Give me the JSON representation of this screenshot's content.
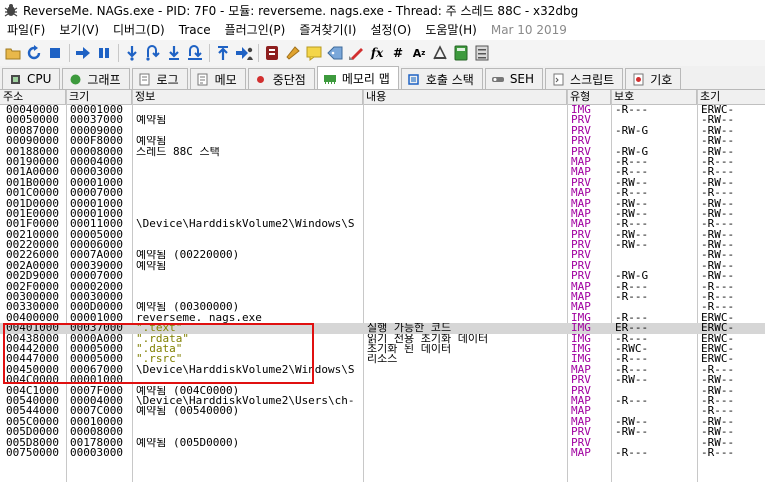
{
  "window": {
    "title": "ReverseMe. NAGs.exe - PID: 7F0 - 모듈: reverseme. nags.exe - Thread: 주 스레드 88C - x32dbg"
  },
  "menu": [
    "파일(F)",
    "보기(V)",
    "디버그(D)",
    "Trace",
    "플러그인(P)",
    "즐겨찾기(I)",
    "설정(O)",
    "도움말(H)"
  ],
  "menu_date": "Mar 10 2019",
  "toolbar": {
    "icons": [
      "open-icon",
      "restart-icon",
      "stop-icon",
      "run-icon",
      "pause-icon",
      "step-into-icon",
      "step-over-icon",
      "trace-into-icon",
      "trace-over-icon",
      "execute-till-return-icon",
      "run-to-user-code-icon",
      "script-icon",
      "patch-icon",
      "comment-icon",
      "label-icon",
      "bookmark-icon",
      "function-icon",
      "hash-icon",
      "font-icon",
      "strings-icon",
      "calculator-icon",
      "settings-icon"
    ],
    "colors": {
      "blue": "#1f62c4",
      "red": "#d22f2f",
      "orange": "#e0a32f",
      "green": "#3d9a3d"
    }
  },
  "tabs": [
    {
      "label": "CPU",
      "icon": "cpu-icon"
    },
    {
      "label": "그래프",
      "icon": "graph-icon"
    },
    {
      "label": "로그",
      "icon": "log-icon"
    },
    {
      "label": "메모",
      "icon": "notes-icon"
    },
    {
      "label": "중단점",
      "icon": "breakpoint-icon"
    },
    {
      "label": "메모리 맵",
      "icon": "memory-map-icon"
    },
    {
      "label": "호출 스택",
      "icon": "call-stack-icon"
    },
    {
      "label": "SEH",
      "icon": "seh-icon"
    },
    {
      "label": "스크립트",
      "icon": "script-tab-icon"
    },
    {
      "label": "기호",
      "icon": "symbols-icon"
    }
  ],
  "active_tab": 5,
  "columns": [
    "주소",
    "크기",
    "정보",
    "내용",
    "유형",
    "보호",
    "초기"
  ],
  "rows": [
    {
      "addr": "00040000",
      "size": "00001000",
      "info": "",
      "content": "",
      "type": "IMG",
      "prot": "-R---",
      "init": "ERWC-"
    },
    {
      "addr": "00050000",
      "size": "00037000",
      "info": "예약됨",
      "content": "",
      "type": "PRV",
      "prot": "",
      "init": "-RW--"
    },
    {
      "addr": "00087000",
      "size": "00009000",
      "info": "",
      "content": "",
      "type": "PRV",
      "prot": "-RW-G",
      "init": "-RW--"
    },
    {
      "addr": "00090000",
      "size": "000F8000",
      "info": "예약됨",
      "content": "",
      "type": "PRV",
      "prot": "",
      "init": "-RW--"
    },
    {
      "addr": "00188000",
      "size": "00008000",
      "info": "스레드 88C 스택",
      "content": "",
      "type": "PRV",
      "prot": "-RW-G",
      "init": "-RW--"
    },
    {
      "addr": "00190000",
      "size": "00004000",
      "info": "",
      "content": "",
      "type": "MAP",
      "prot": "-R---",
      "init": "-R---"
    },
    {
      "addr": "001A0000",
      "size": "00003000",
      "info": "",
      "content": "",
      "type": "MAP",
      "prot": "-R---",
      "init": "-R---"
    },
    {
      "addr": "001B0000",
      "size": "00001000",
      "info": "",
      "content": "",
      "type": "PRV",
      "prot": "-RW--",
      "init": "-RW--"
    },
    {
      "addr": "001C0000",
      "size": "00007000",
      "info": "",
      "content": "",
      "type": "MAP",
      "prot": "-R---",
      "init": "-R---"
    },
    {
      "addr": "001D0000",
      "size": "00001000",
      "info": "",
      "content": "",
      "type": "MAP",
      "prot": "-RW--",
      "init": "-RW--"
    },
    {
      "addr": "001E0000",
      "size": "00001000",
      "info": "",
      "content": "",
      "type": "MAP",
      "prot": "-RW--",
      "init": "-RW--"
    },
    {
      "addr": "001F0000",
      "size": "00011000",
      "info": "\\Device\\HarddiskVolume2\\Windows\\S",
      "content": "",
      "type": "MAP",
      "prot": "-R---",
      "init": "-R---"
    },
    {
      "addr": "00210000",
      "size": "00005000",
      "info": "",
      "content": "",
      "type": "PRV",
      "prot": "-RW--",
      "init": "-RW--"
    },
    {
      "addr": "00220000",
      "size": "00006000",
      "info": "",
      "content": "",
      "type": "PRV",
      "prot": "-RW--",
      "init": "-RW--"
    },
    {
      "addr": "00226000",
      "size": "0007A000",
      "info": "예약됨 (00220000)",
      "content": "",
      "type": "PRV",
      "prot": "",
      "init": "-RW--"
    },
    {
      "addr": "002A0000",
      "size": "00039000",
      "info": "예약됨",
      "content": "",
      "type": "PRV",
      "prot": "",
      "init": "-RW--"
    },
    {
      "addr": "002D9000",
      "size": "00007000",
      "info": "",
      "content": "",
      "type": "PRV",
      "prot": "-RW-G",
      "init": "-RW--"
    },
    {
      "addr": "002F0000",
      "size": "00002000",
      "info": "",
      "content": "",
      "type": "MAP",
      "prot": "-R---",
      "init": "-R---"
    },
    {
      "addr": "00300000",
      "size": "00030000",
      "info": "",
      "content": "",
      "type": "MAP",
      "prot": "-R---",
      "init": "-R---"
    },
    {
      "addr": "00330000",
      "size": "000D0000",
      "info": "예약됨 (00300000)",
      "content": "",
      "type": "MAP",
      "prot": "",
      "init": "-R---"
    },
    {
      "addr": "00400000",
      "size": "00001000",
      "info": "reverseme. nags.exe",
      "content": "",
      "type": "IMG",
      "prot": "-R---",
      "init": "ERWC-"
    },
    {
      "addr": "00401000",
      "size": "00037000",
      "info": " \".text\"",
      "content": "실행 가능한 코드",
      "type": "IMG",
      "prot": "ER---",
      "init": "ERWC-"
    },
    {
      "addr": "00438000",
      "size": "0000A000",
      "info": " \".rdata\"",
      "content": "읽기 전용 초기화 데이터",
      "type": "IMG",
      "prot": "-R---",
      "init": "ERWC-"
    },
    {
      "addr": "00442000",
      "size": "00005000",
      "info": " \".data\"",
      "content": "초기화 된 데이터",
      "type": "IMG",
      "prot": "-RWC-",
      "init": "ERWC-"
    },
    {
      "addr": "00447000",
      "size": "00005000",
      "info": " \".rsrc\"",
      "content": "리소스",
      "type": "IMG",
      "prot": "-R---",
      "init": "ERWC-"
    },
    {
      "addr": "00450000",
      "size": "00067000",
      "info": "\\Device\\HarddiskVolume2\\Windows\\S",
      "content": "",
      "type": "MAP",
      "prot": "-R---",
      "init": "-R---"
    },
    {
      "addr": "004C0000",
      "size": "00001000",
      "info": "",
      "content": "",
      "type": "PRV",
      "prot": "-RW--",
      "init": "-RW--"
    },
    {
      "addr": "004C1000",
      "size": "0007F000",
      "info": "예약됨 (004C0000)",
      "content": "",
      "type": "PRV",
      "prot": "",
      "init": "-RW--"
    },
    {
      "addr": "00540000",
      "size": "00004000",
      "info": "\\Device\\HarddiskVolume2\\Users\\ch-",
      "content": "",
      "type": "MAP",
      "prot": "-R---",
      "init": "-R---"
    },
    {
      "addr": "00544000",
      "size": "0007C000",
      "info": "예약됨 (00540000)",
      "content": "",
      "type": "MAP",
      "prot": "",
      "init": "-R---"
    },
    {
      "addr": "005C0000",
      "size": "00010000",
      "info": "",
      "content": "",
      "type": "MAP",
      "prot": "-RW--",
      "init": "-RW--"
    },
    {
      "addr": "005D0000",
      "size": "00008000",
      "info": "",
      "content": "",
      "type": "PRV",
      "prot": "-RW--",
      "init": "-RW--"
    },
    {
      "addr": "005D8000",
      "size": "00178000",
      "info": "예약됨 (005D0000)",
      "content": "",
      "type": "PRV",
      "prot": "",
      "init": "-RW--"
    },
    {
      "addr": "00750000",
      "size": "00003000",
      "info": "",
      "content": "",
      "type": "MAP",
      "prot": "-R---",
      "init": "-R---"
    }
  ],
  "selected_row": 21,
  "highlight_box_color": "#e01010"
}
